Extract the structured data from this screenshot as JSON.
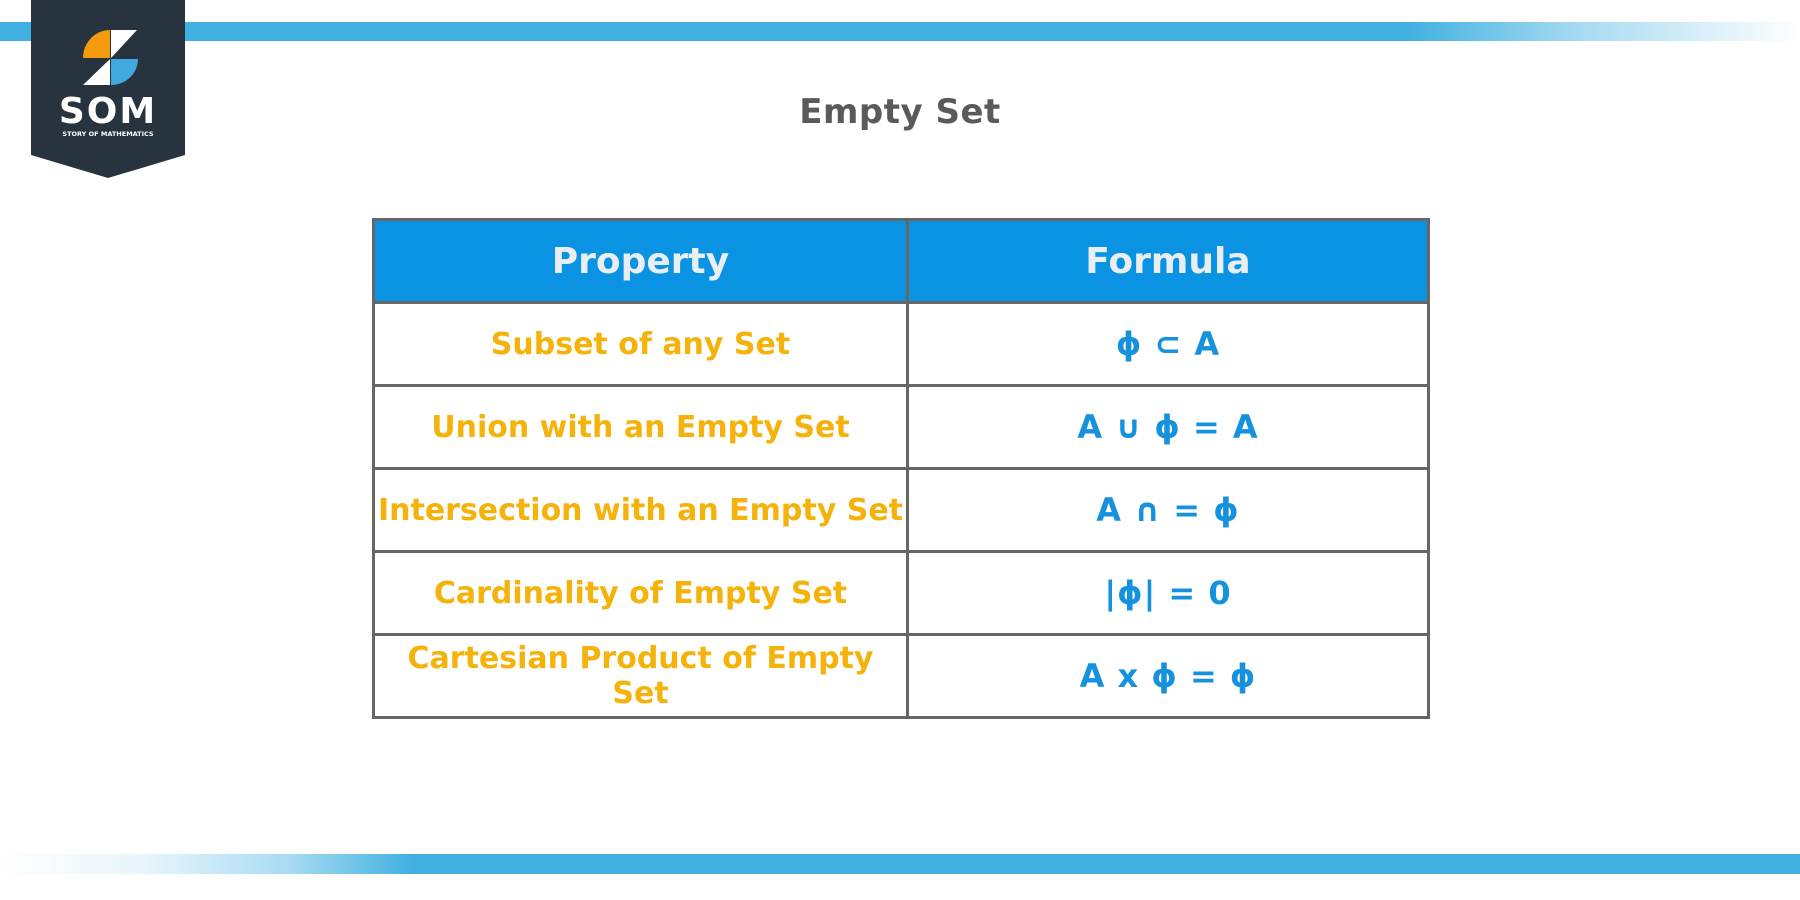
{
  "brand": {
    "name": "SOM",
    "tagline": "STORY OF MATHEMATICS",
    "colors": {
      "badge": "#27343f",
      "orange": "#f49a0c",
      "blue": "#3fa9e0",
      "white": "#ffffff"
    }
  },
  "page": {
    "title": "Empty Set"
  },
  "table": {
    "headers": [
      "Property",
      "Formula"
    ],
    "rows": [
      {
        "property": "Subset of any Set",
        "formula": "ϕ ⊂ A"
      },
      {
        "property": "Union with an Empty Set",
        "formula": "A ∪ ϕ = A"
      },
      {
        "property": "Intersection with an Empty Set",
        "formula": "A ∩ = ϕ"
      },
      {
        "property": "Cardinality of Empty Set",
        "formula": "|ϕ| = 0"
      },
      {
        "property": "Cartesian Product of Empty Set",
        "formula": "A x ϕ = ϕ"
      }
    ],
    "colors": {
      "header_bg": "#0b93e3",
      "header_text": "#e9eef2",
      "property_text": "#f5b20a",
      "formula_text": "#1591dd",
      "border": "#666666"
    }
  },
  "decorations": {
    "bar_color": "#3fb0e0"
  }
}
